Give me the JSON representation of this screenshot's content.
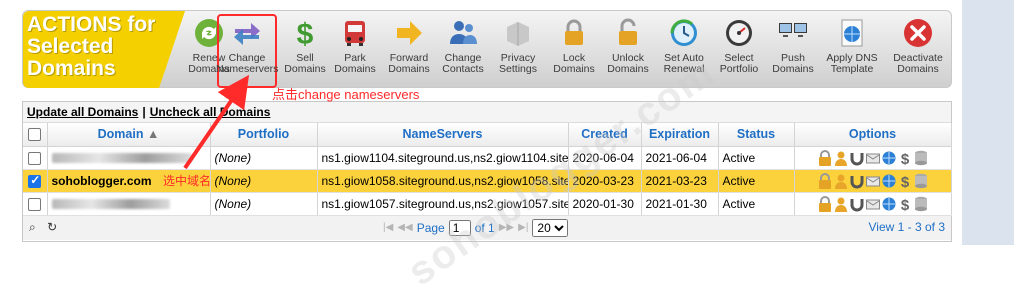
{
  "toolbar": {
    "title": "ACTIONS for\nSelected\nDomains",
    "buttons": [
      {
        "label": "Renew\nDomains",
        "icon": "renew-icon"
      },
      {
        "label": "Change\nNameservers",
        "icon": "change-arrows-icon"
      },
      {
        "label": "Sell\nDomains",
        "icon": "dollar-icon"
      },
      {
        "label": "Park\nDomains",
        "icon": "bus-icon"
      },
      {
        "label": "Forward\nDomains",
        "icon": "arrow-right-icon"
      },
      {
        "label": "Change\nContacts",
        "icon": "contacts-icon"
      },
      {
        "label": "Privacy\nSettings",
        "icon": "privacy-icon"
      },
      {
        "label": "Lock\nDomains",
        "icon": "lock-icon"
      },
      {
        "label": "Unlock\nDomains",
        "icon": "unlock-icon"
      },
      {
        "label": "Set Auto\nRenewal",
        "icon": "clock-icon"
      },
      {
        "label": "Select\nPortfolio",
        "icon": "gauge-icon"
      },
      {
        "label": "Push\nDomains",
        "icon": "monitors-icon"
      },
      {
        "label": "Apply DNS\nTemplate",
        "icon": "globe-doc-icon"
      },
      {
        "label": "Deactivate\nDomains",
        "icon": "close-icon"
      }
    ]
  },
  "annotations": {
    "change": "点击change nameservers",
    "select": "选中域名"
  },
  "grid": {
    "update_all": "Update all Domains",
    "uncheck_all": "Uncheck all Domains",
    "columns": [
      "Domain",
      "Portfolio",
      "NameServers",
      "Created",
      "Expiration",
      "Status",
      "Options"
    ],
    "rows": [
      {
        "domain": "",
        "portfolio": "(None)",
        "nameservers": "ns1.giow1104.siteground.us,ns2.giow1104.site",
        "created": "2020-06-04",
        "expiration": "2021-06-04",
        "status": "Active",
        "checked": false
      },
      {
        "domain": "sohoblogger.com",
        "portfolio": "(None)",
        "nameservers": "ns1.giow1058.siteground.us,ns2.giow1058.site",
        "created": "2020-03-23",
        "expiration": "2021-03-23",
        "status": "Active",
        "checked": true
      },
      {
        "domain": "",
        "portfolio": "(None)",
        "nameservers": "ns1.giow1057.siteground.us,ns2.giow1057.site",
        "created": "2020-01-30",
        "expiration": "2021-01-30",
        "status": "Active",
        "checked": false
      }
    ]
  },
  "pager": {
    "page_label": "Page",
    "page_value": "1",
    "of_label": "of 1",
    "page_size": "20",
    "view_info": "View 1 - 3 of 3"
  },
  "colors": {
    "brand": "#f5d000",
    "highlight": "#ff2a2a",
    "selected_row": "#fbd23c",
    "link": "#1f6fc5"
  }
}
